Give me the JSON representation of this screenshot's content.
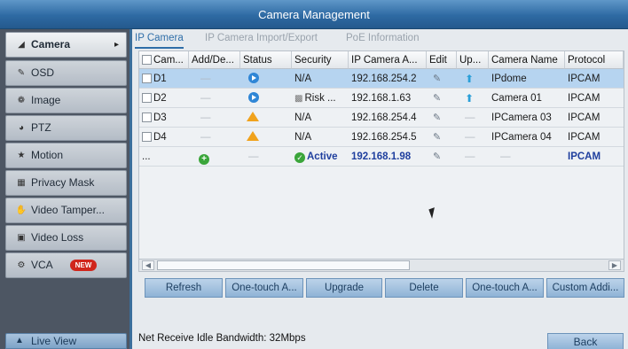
{
  "window": {
    "title": "Camera Management"
  },
  "sidebar": {
    "items": [
      {
        "label": "Camera",
        "icon": "camera-icon",
        "active": true
      },
      {
        "label": "OSD",
        "icon": "osd-icon"
      },
      {
        "label": "Image",
        "icon": "image-icon"
      },
      {
        "label": "PTZ",
        "icon": "ptz-icon"
      },
      {
        "label": "Motion",
        "icon": "motion-icon"
      },
      {
        "label": "Privacy Mask",
        "icon": "privacy-mask-icon"
      },
      {
        "label": "Video Tamper...",
        "icon": "video-tamper-icon"
      },
      {
        "label": "Video Loss",
        "icon": "video-loss-icon"
      },
      {
        "label": "VCA",
        "icon": "vca-icon",
        "badge": "NEW"
      }
    ],
    "live_view": "Live View"
  },
  "tabs": [
    "IP Camera",
    "IP Camera Import/Export",
    "PoE Information"
  ],
  "table": {
    "headers": [
      "Cam...",
      "Add/De...",
      "Status",
      "Security",
      "IP Camera A...",
      "Edit",
      "Up...",
      "Camera Name",
      "Protocol"
    ],
    "rows": [
      {
        "cam": "D1",
        "security": "N/A",
        "ip": "192.168.254.2",
        "name": "IPdome",
        "protocol": "IPCAM",
        "status": "play",
        "upgrade": true,
        "selected": true
      },
      {
        "cam": "D2",
        "security": "Risk ...",
        "ip": "192.168.1.63",
        "name": "Camera 01",
        "protocol": "IPCAM",
        "status": "play",
        "upgrade": true
      },
      {
        "cam": "D3",
        "security": "N/A",
        "ip": "192.168.254.4",
        "name": "IPCamera 03",
        "protocol": "IPCAM",
        "status": "warn"
      },
      {
        "cam": "D4",
        "security": "N/A",
        "ip": "192.168.254.5",
        "name": "IPCamera 04",
        "protocol": "IPCAM",
        "status": "warn"
      },
      {
        "cam": "...",
        "security": "Active",
        "ip": "192.168.1.98",
        "name": "",
        "protocol": "IPCAM",
        "status": "none",
        "add": true
      }
    ]
  },
  "buttons": [
    "Refresh",
    "One-touch A...",
    "Upgrade",
    "Delete",
    "One-touch A...",
    "Custom Addi..."
  ],
  "footer": {
    "bandwidth": "Net Receive Idle Bandwidth: 32Mbps",
    "back": "Back"
  },
  "colors": {
    "title_bar": "#2e6aa3",
    "selected_row": "#b6d4f0",
    "accent": "#2f6ea8",
    "new_badge": "#d0261c"
  }
}
